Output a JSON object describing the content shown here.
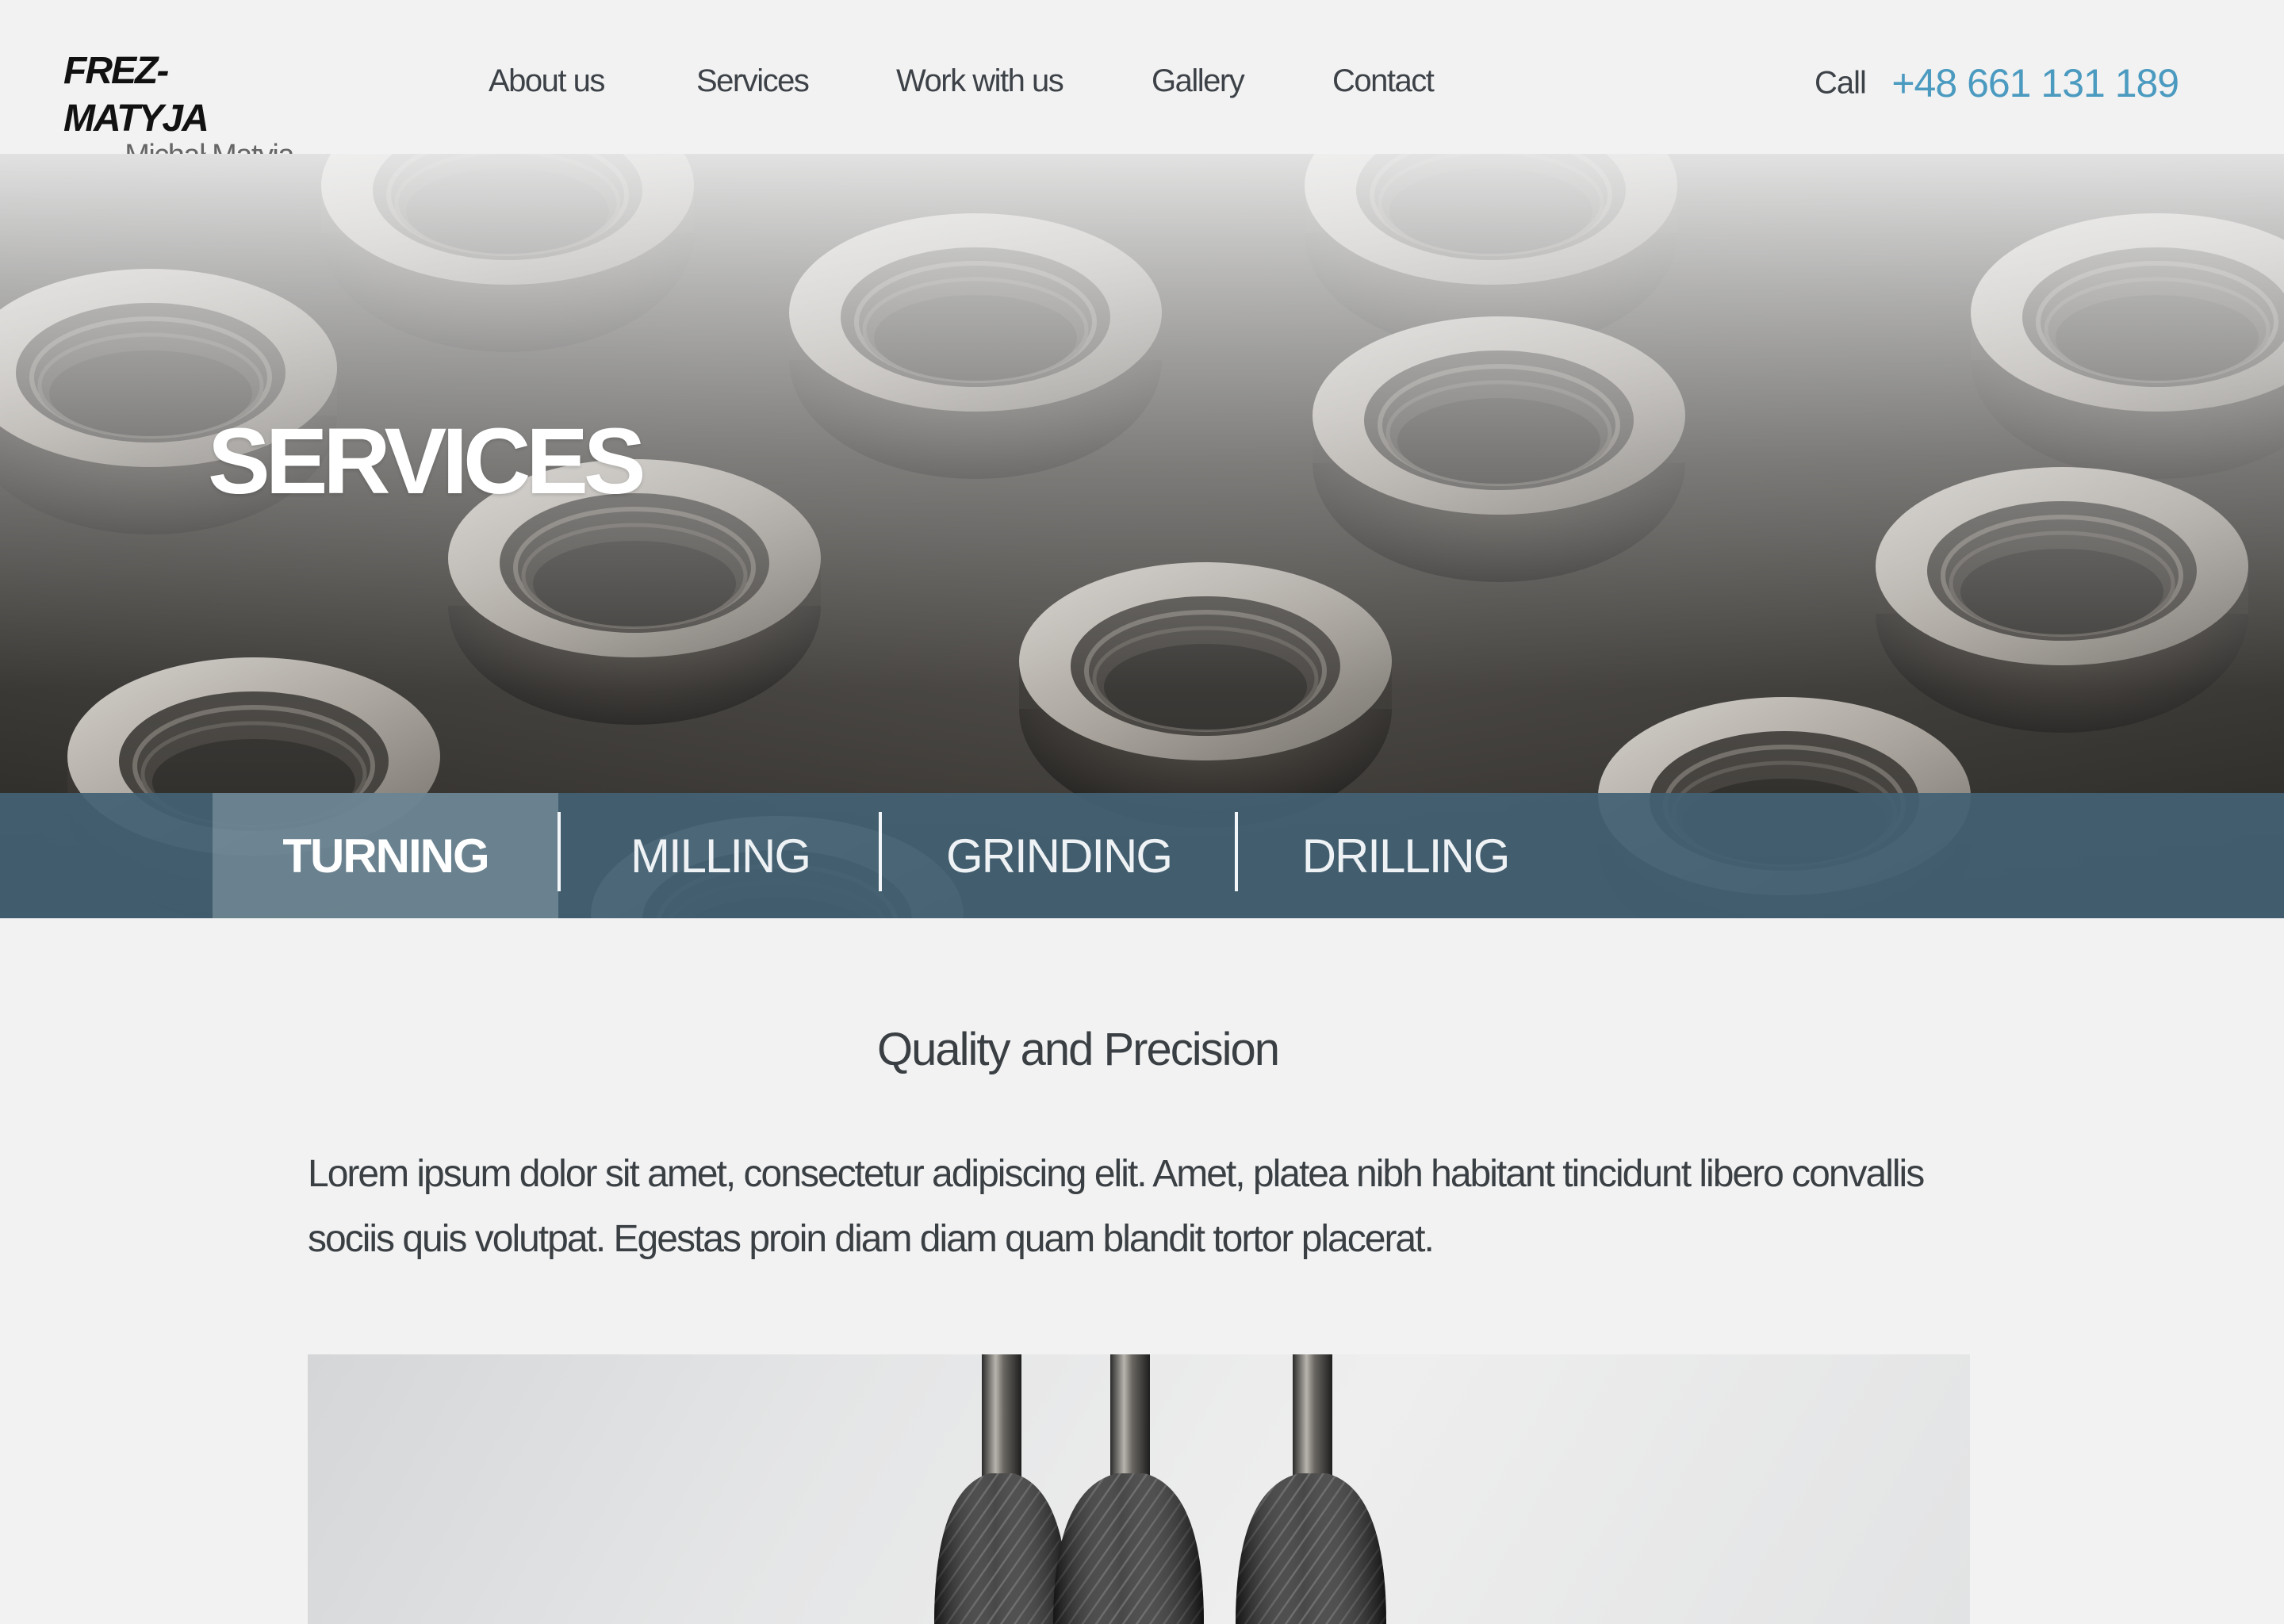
{
  "logo": {
    "title": "FREZ-MATYJA",
    "subtitle": "Michał Matyja"
  },
  "nav": {
    "items": [
      {
        "label": "About us"
      },
      {
        "label": "Services"
      },
      {
        "label": "Work with us"
      },
      {
        "label": "Gallery"
      },
      {
        "label": "Contact"
      }
    ]
  },
  "call": {
    "label": "Call",
    "phone": "+48 661 131 189"
  },
  "hero": {
    "title": "SERVICES",
    "image": "threaded-metal-nuts-photo"
  },
  "tabs": {
    "active": "TURNING",
    "items": [
      {
        "label": "TURNING"
      },
      {
        "label": "MILLING"
      },
      {
        "label": "GRINDING"
      },
      {
        "label": "DRILLING"
      }
    ]
  },
  "content": {
    "heading": "Quality and Precision",
    "paragraph": "Lorem ipsum dolor sit amet, consectetur adipiscing elit. Amet, platea nibh habitant tincidunt libero convallis sociis quis volutpat. Egestas proin diam diam quam blandit tortor placerat.",
    "image": "knurled-steel-rods-photo"
  },
  "colors": {
    "background": "#f2f2f2",
    "text": "#3a3f44",
    "accent_phone": "#4b9ac0",
    "tab_bar": "#436173"
  }
}
